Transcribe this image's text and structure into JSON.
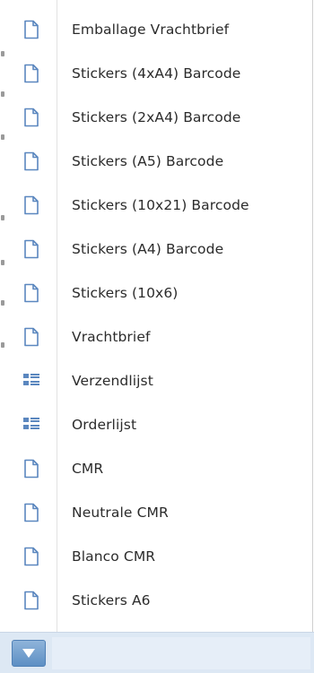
{
  "menu": {
    "items": [
      {
        "label": "Emballage Vrachtbrief",
        "icon": "document-icon"
      },
      {
        "label": "Stickers (4xA4) Barcode",
        "icon": "document-icon"
      },
      {
        "label": "Stickers (2xA4) Barcode",
        "icon": "document-icon"
      },
      {
        "label": "Stickers (A5) Barcode",
        "icon": "document-icon"
      },
      {
        "label": "Stickers (10x21) Barcode",
        "icon": "document-icon"
      },
      {
        "label": "Stickers (A4) Barcode",
        "icon": "document-icon"
      },
      {
        "label": "Stickers (10x6)",
        "icon": "document-icon"
      },
      {
        "label": "Vrachtbrief",
        "icon": "document-icon"
      },
      {
        "label": "Verzendlijst",
        "icon": "list-icon"
      },
      {
        "label": "Orderlijst",
        "icon": "list-icon"
      },
      {
        "label": "CMR",
        "icon": "document-icon"
      },
      {
        "label": "Neutrale CMR",
        "icon": "document-icon"
      },
      {
        "label": "Blanco CMR",
        "icon": "document-icon"
      },
      {
        "label": "Stickers A6",
        "icon": "document-icon"
      }
    ]
  },
  "toolbar": {
    "trigger_icon": "triangle-down-icon"
  },
  "colors": {
    "icon_blue": "#5b87bf",
    "text": "#2b2b2b",
    "trigger": "#6b98c9"
  }
}
